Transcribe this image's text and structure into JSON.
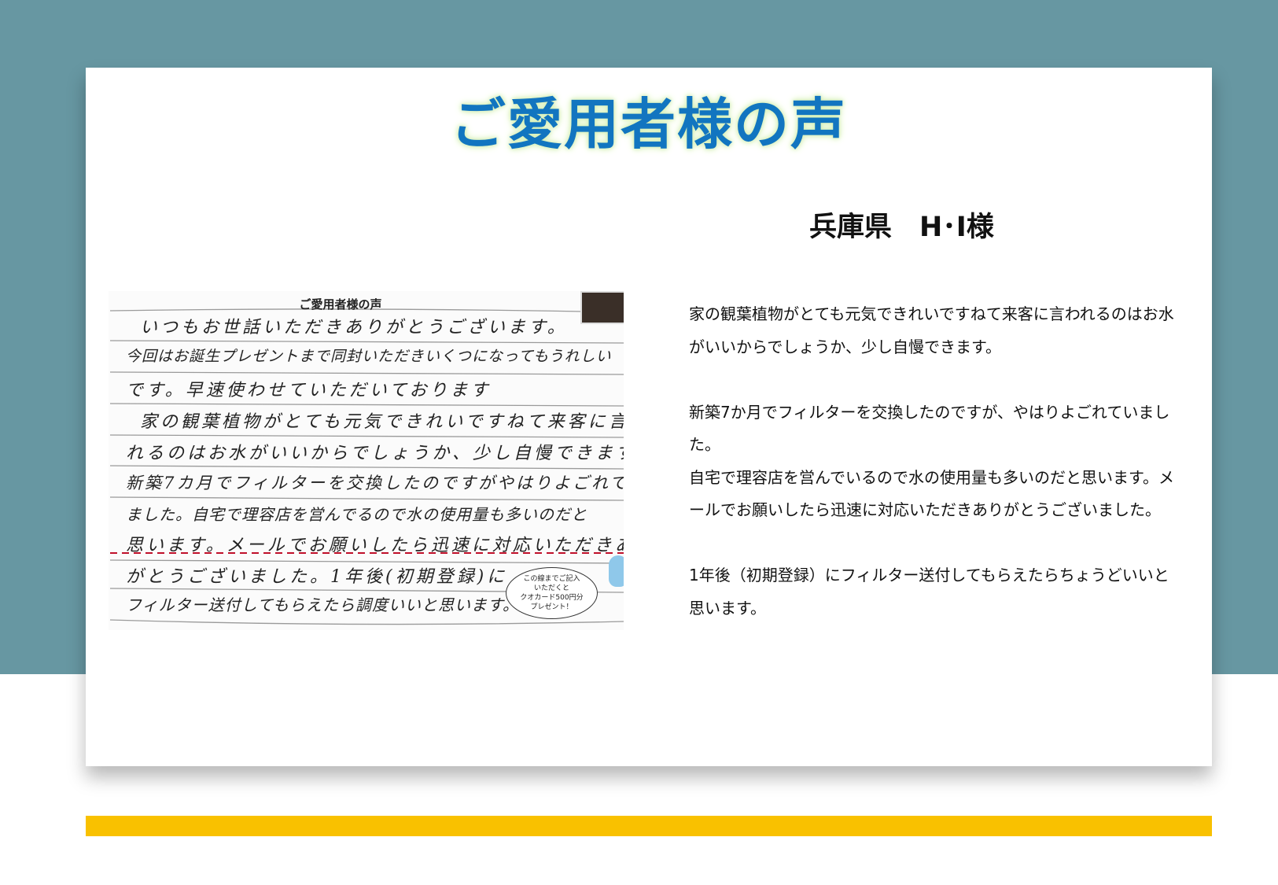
{
  "page": {
    "title": "ご愛用者様の声",
    "customer": "兵庫県　H･I様",
    "paragraphs": [
      [
        "家の観葉植物がとても元気できれいですねて来客に言われるのはお水がいいからでしょうか、少し自慢できます。"
      ],
      [
        "新築7か月でフィルターを交換したのですが、やはりよごれていました。",
        "自宅で理容店を営んでいるので水の使用量も多いのだと思います。メールでお願いしたら迅速に対応いただきありがとうございました。"
      ],
      [
        "1年後（初期登録）にフィルター送付してもらえたらちょうどいいと思います。"
      ]
    ]
  },
  "note_image": {
    "header": "ご愛用者様の声",
    "lines": [
      "いつもお世話いただきありがとうございます。",
      "今回はお誕生プレゼントまで同封いただきいくつになってもうれしい",
      "です。早速使わせていただいております",
      "家の観葉植物がとても元気できれいですねて来客に言わ",
      "れるのはお水がいいからでしょうか、少し自慢できます",
      "新築7カ月でフィルターを交換したのですがやはりよごれて",
      "ました。自宅で理容店を営んでるので水の使用量も多いのだと",
      "思います。メールでお願いしたら迅速に対応いただきあり",
      "がとうございました。1年後(初期登録)に",
      "フィルター送付してもらえたら調度いいと思います。"
    ],
    "bubble": [
      "この線までご記入",
      "いただくと",
      "クオカード500円分",
      "プレゼント！"
    ]
  },
  "colors": {
    "background_top": "#6797a2",
    "title": "#1275c0",
    "accent_bar": "#f9c100",
    "dashed_line": "#c0102a"
  }
}
